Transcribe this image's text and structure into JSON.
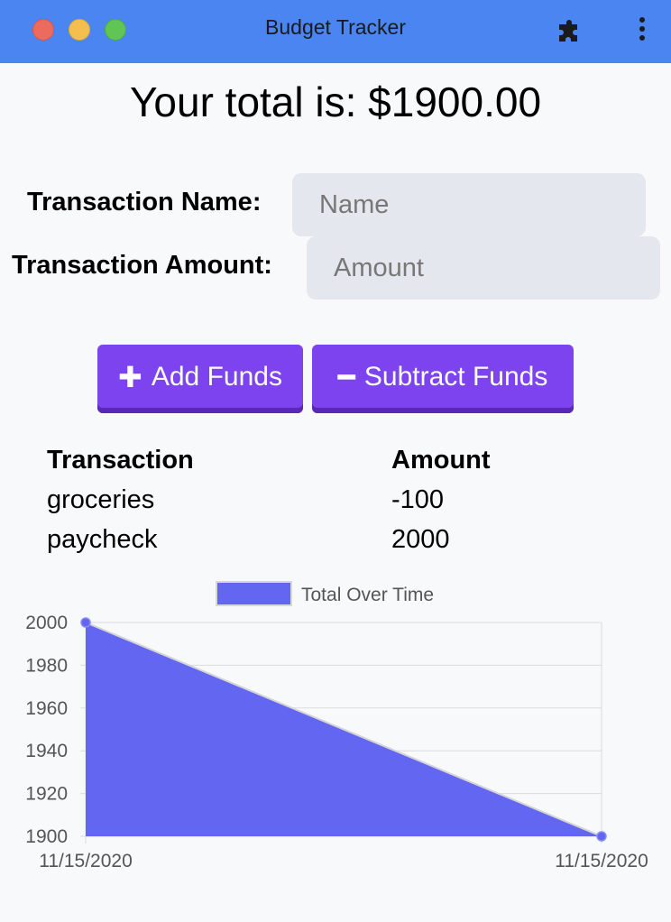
{
  "window": {
    "title": "Budget Tracker",
    "extension_icon": "puzzle-icon",
    "menu_icon": "kebab-menu-icon"
  },
  "total": {
    "label": "Your total is: $",
    "value": "1900.00"
  },
  "form": {
    "name_label": "Transaction Name:",
    "name_placeholder": "Name",
    "amount_label": "Transaction Amount:",
    "amount_placeholder": "Amount"
  },
  "buttons": {
    "add_label": "Add Funds",
    "add_icon": "plus-icon",
    "subtract_label": "Subtract Funds",
    "subtract_icon": "minus-icon",
    "color": "#7c43ee"
  },
  "table": {
    "headers": [
      "Transaction",
      "Amount"
    ],
    "rows": [
      {
        "name": "groceries",
        "amount": "-100"
      },
      {
        "name": "paycheck",
        "amount": "2000"
      }
    ]
  },
  "chart_data": {
    "type": "area",
    "x": [
      "11/15/2020",
      "11/15/2020"
    ],
    "series": [
      {
        "name": "Total Over Time",
        "values": [
          2000,
          1900
        ],
        "color": "#6366f1"
      }
    ],
    "ylim": [
      1900,
      2000
    ],
    "yticks": [
      2000,
      1980,
      1960,
      1940,
      1920,
      1900
    ],
    "legend": "top-center",
    "grid": true
  }
}
